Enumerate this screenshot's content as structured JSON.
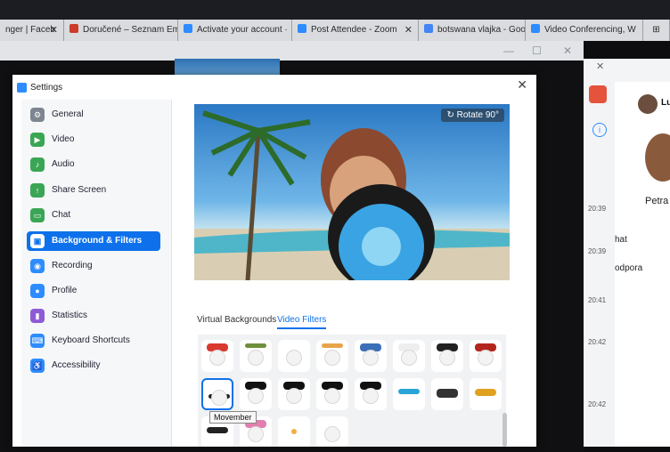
{
  "browser_tabs": [
    {
      "label": "nger | Faceb",
      "color": "#3b5998"
    },
    {
      "label": "Doručené – Seznam Em",
      "color": "#cc3b2b"
    },
    {
      "label": "Activate your account ·",
      "color": "#2d8cff"
    },
    {
      "label": "Post Attendee - Zoom",
      "color": "#2d8cff"
    },
    {
      "label": "botswana vlajka - Goo",
      "color": "#4285f4"
    },
    {
      "label": "Video Conferencing, W",
      "color": "#2d8cff"
    }
  ],
  "settings": {
    "title": "Settings",
    "close": "✕",
    "nav": [
      {
        "label": "General",
        "color": "#7d8590",
        "glyph": "⚙"
      },
      {
        "label": "Video",
        "color": "#3aa655",
        "glyph": "▶"
      },
      {
        "label": "Audio",
        "color": "#3aa655",
        "glyph": "♪"
      },
      {
        "label": "Share Screen",
        "color": "#3aa655",
        "glyph": "↑"
      },
      {
        "label": "Chat",
        "color": "#3aa655",
        "glyph": "▭"
      },
      {
        "label": "Background & Filters",
        "color": "#ffffff",
        "glyph": "▣"
      },
      {
        "label": "Recording",
        "color": "#2d8cff",
        "glyph": "◉"
      },
      {
        "label": "Profile",
        "color": "#2d8cff",
        "glyph": "●"
      },
      {
        "label": "Statistics",
        "color": "#8e5bd6",
        "glyph": "▮"
      },
      {
        "label": "Keyboard Shortcuts",
        "color": "#2d8cff",
        "glyph": "⌨"
      },
      {
        "label": "Accessibility",
        "color": "#2d8cff",
        "glyph": "♿"
      }
    ],
    "active_index": 5,
    "rotate_label": "Rotate 90°",
    "tabs": {
      "virtual_backgrounds": "Virtual Backgrounds",
      "video_filters": "Video Filters"
    },
    "tooltip": "Movember"
  },
  "chat_panel": {
    "name_partial": "Lu",
    "contact_partial": "Petra",
    "msg_partial_1": "hat",
    "msg_partial_2": "odpora",
    "times": [
      "20:39",
      "20:39",
      "20:41",
      "20:42",
      "20:42"
    ]
  },
  "colors": {
    "accent": "#0e71eb"
  }
}
